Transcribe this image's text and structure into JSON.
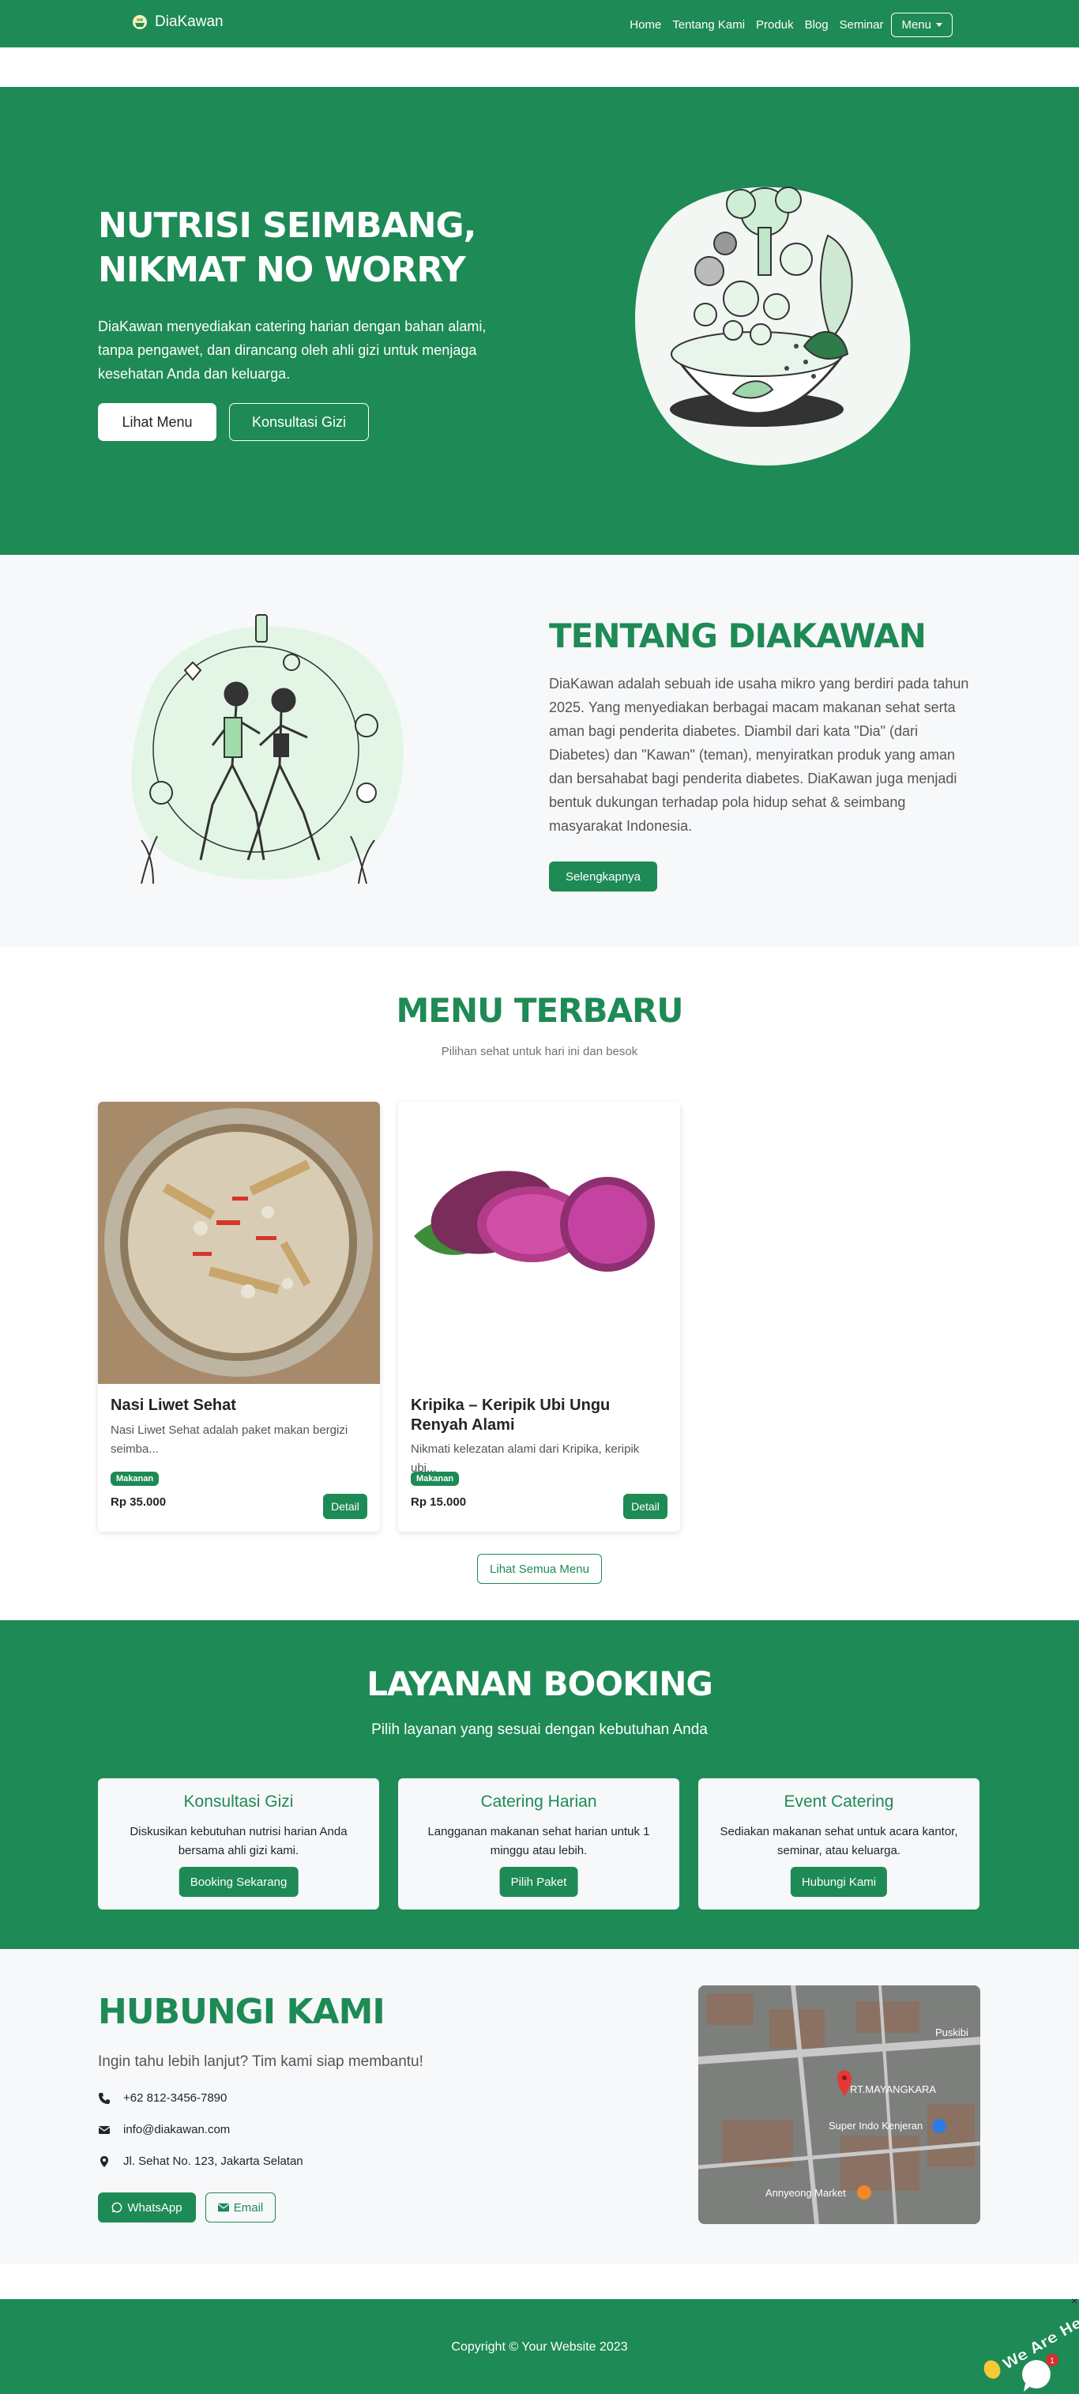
{
  "nav": {
    "brand": "DiaKawan",
    "links": [
      "Home",
      "Tentang Kami",
      "Produk",
      "Blog",
      "Seminar"
    ],
    "menu_button": "Menu"
  },
  "hero": {
    "title": "Nutrisi Seimbang, Nikmat No Worry",
    "text": "DiaKawan menyediakan catering harian dengan bahan alami, tanpa pengawet, dan dirancang oleh ahli gizi untuk menjaga kesehatan Anda dan keluarga.",
    "btn_menu": "Lihat Menu",
    "btn_consult": "Konsultasi Gizi"
  },
  "about": {
    "title": "Tentang DiaKawan",
    "text": "DiaKawan adalah sebuah ide usaha mikro yang berdiri pada tahun 2025. Yang menyediakan berbagai macam makanan sehat serta aman bagi penderita diabetes. Diambil dari kata \"Dia\" (dari Diabetes) dan \"Kawan\" (teman), menyiratkan produk yang aman dan bersahabat bagi penderita diabetes. DiaKawan juga menjadi bentuk dukungan terhadap pola hidup sehat & seimbang masyarakat Indonesia.",
    "button": "Selengkapnya"
  },
  "menu": {
    "title": "Menu Terbaru",
    "subtitle": "Pilihan sehat untuk hari ini dan besok",
    "items": [
      {
        "name": "Nasi Liwet Sehat",
        "desc": "Nasi Liwet Sehat adalah paket makan bergizi seimba...",
        "badge": "Makanan",
        "price": "Rp 35.000",
        "button": "Detail"
      },
      {
        "name": "Kripika – Keripik Ubi Ungu Renyah Alami",
        "desc": "Nikmati kelezatan alami dari Kripika, keripik ubi...",
        "badge": "Makanan",
        "price": "Rp 15.000",
        "button": "Detail"
      }
    ],
    "all_button": "Lihat Semua Menu"
  },
  "booking": {
    "title": "Layanan Booking",
    "subtitle": "Pilih layanan yang sesuai dengan kebutuhan Anda",
    "cards": [
      {
        "title": "Konsultasi Gizi",
        "text": "Diskusikan kebutuhan nutrisi harian Anda bersama ahli gizi kami.",
        "button": "Booking Sekarang"
      },
      {
        "title": "Catering Harian",
        "text": "Langganan makanan sehat harian untuk 1 minggu atau lebih.",
        "button": "Pilih Paket"
      },
      {
        "title": "Event Catering",
        "text": "Sediakan makanan sehat untuk acara kantor, seminar, atau keluarga.",
        "button": "Hubungi Kami"
      }
    ]
  },
  "contact": {
    "title": "Hubungi Kami",
    "subtitle": "Ingin tahu lebih lanjut? Tim kami siap membantu!",
    "phone": "+62 812-3456-7890",
    "email": "info@diakawan.com",
    "address": "Jl. Sehat No. 123, Jakarta Selatan",
    "btn_whatsapp": "WhatsApp",
    "btn_email": "Email",
    "map_labels": [
      "RT.MAYANGKARA",
      "Super Indo Kenjeran",
      "Annyeong Market",
      "Puskibi"
    ]
  },
  "footer": {
    "copyright": "Copyright © Your Website 2023"
  },
  "chat": {
    "label": "We Are Here!",
    "count": "1"
  }
}
